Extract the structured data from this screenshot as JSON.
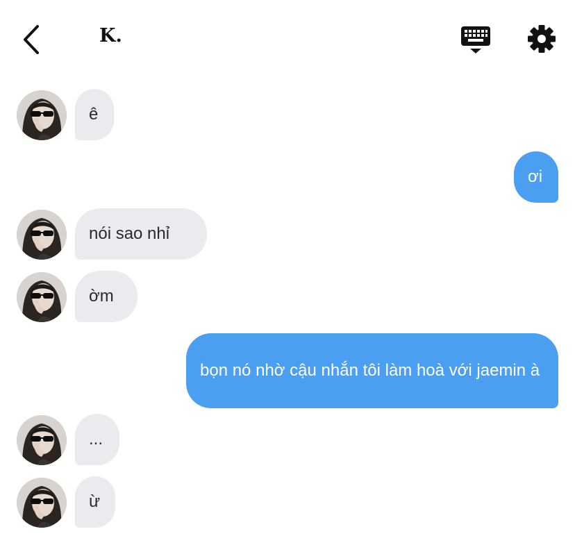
{
  "header": {
    "title": "K.",
    "back_icon": "chevron-left-icon",
    "keyboard_icon": "keyboard-icon",
    "settings_icon": "gear-icon"
  },
  "colors": {
    "incoming_bubble": "#e9ebef",
    "outgoing_bubble": "#4b9ff0"
  },
  "messages": [
    {
      "sender": "K.",
      "direction": "incoming",
      "text": "ê"
    },
    {
      "sender": "me",
      "direction": "outgoing",
      "text": "ơi"
    },
    {
      "sender": "K.",
      "direction": "incoming",
      "text": "nói sao nhỉ"
    },
    {
      "sender": "K.",
      "direction": "incoming",
      "text": "ờm"
    },
    {
      "sender": "me",
      "direction": "outgoing",
      "text": "bọn nó nhờ cậu nhắn tôi làm hoà với jaemin à"
    },
    {
      "sender": "K.",
      "direction": "incoming",
      "text": "..."
    },
    {
      "sender": "K.",
      "direction": "incoming",
      "text": "ừ"
    }
  ]
}
